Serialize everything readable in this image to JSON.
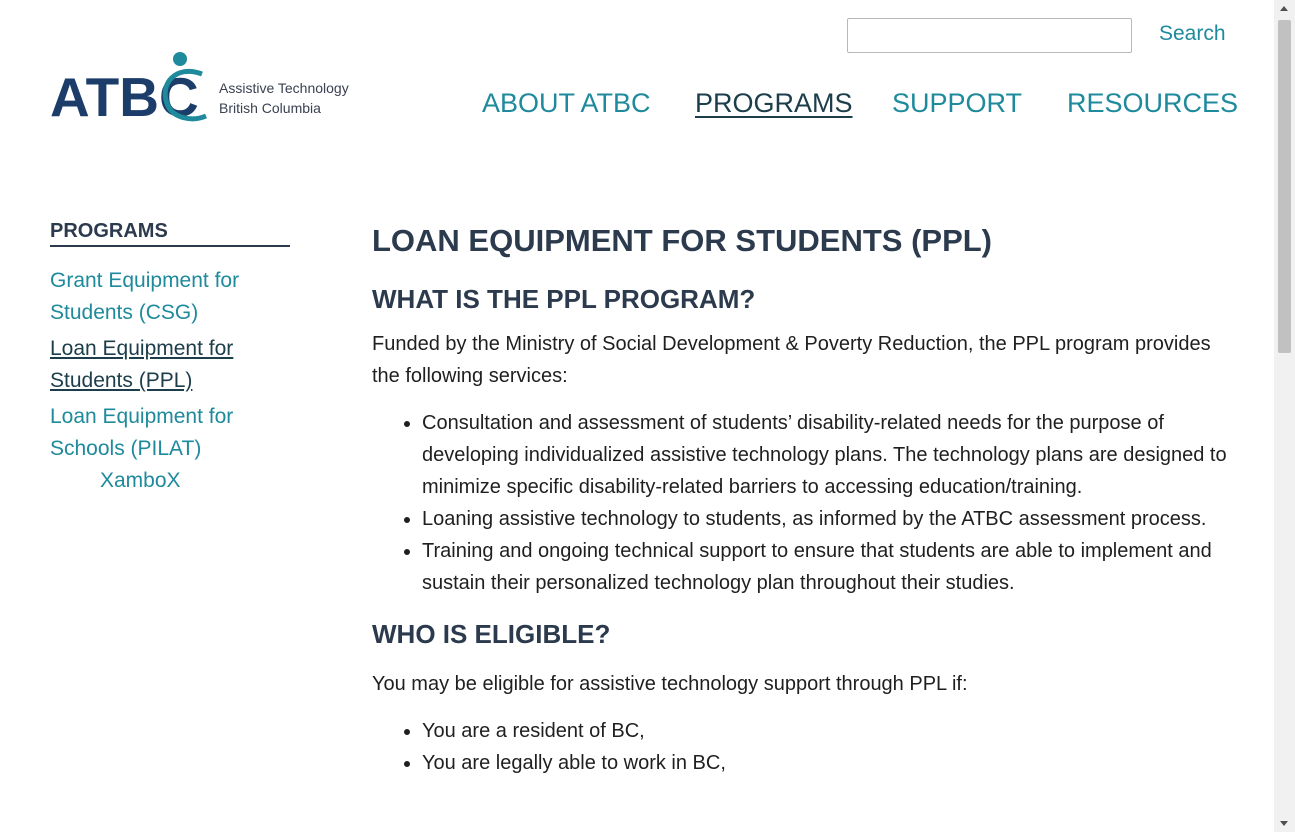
{
  "header": {
    "logo": {
      "mark": "ATBC",
      "line1": "Assistive Technology",
      "line2": "British Columbia"
    },
    "search": {
      "value": "",
      "button_label": "Search"
    },
    "nav": [
      {
        "label": "ABOUT ATBC",
        "active": false
      },
      {
        "label": "PROGRAMS",
        "active": true
      },
      {
        "label": "SUPPORT",
        "active": false
      },
      {
        "label": "RESOURCES",
        "active": false
      }
    ]
  },
  "sidebar": {
    "heading": "PROGRAMS",
    "items": [
      {
        "line1": "Grant Equipment for",
        "line2": "Students (CSG)",
        "active": false
      },
      {
        "line1": "Loan Equipment for",
        "line2": "Students (PPL)",
        "active": true
      },
      {
        "line1": "Loan Equipment for",
        "line2": "Schools (PILAT)",
        "active": false
      }
    ],
    "subitem": "XamboX"
  },
  "main": {
    "title": "LOAN EQUIPMENT FOR STUDENTS (PPL)",
    "section1": {
      "heading": "WHAT IS THE PPL PROGRAM?",
      "intro": "Funded by the Ministry of Social Development & Poverty Reduction, the PPL program provides the following services:",
      "bullets": [
        "Consultation and assessment of students’ disability-related needs for the purpose of developing individualized assistive technology plans. The technology plans are designed to minimize specific disability-related barriers to accessing education/training.",
        "Loaning assistive technology to students, as informed by the ATBC assessment process.",
        "Training and ongoing technical support to ensure that students are able to implement and sustain their personalized technology plan throughout their studies."
      ]
    },
    "section2": {
      "heading": "WHO IS ELIGIBLE?",
      "intro": "You may be eligible for assistive technology support through PPL if:",
      "bullets": [
        "You are a resident of BC,",
        "You are legally able to work in BC,"
      ]
    }
  },
  "colors": {
    "accent": "#1e8a9c",
    "heading": "#2c3a4d",
    "logo": "#1c3d6a"
  }
}
